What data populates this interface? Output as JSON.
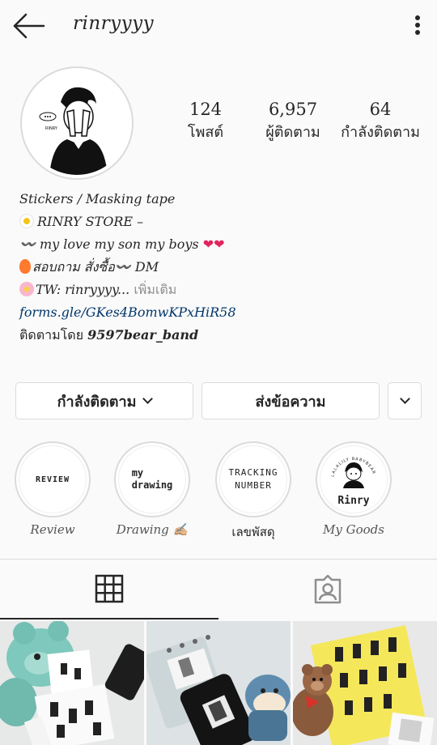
{
  "header": {
    "username": "rinryyyy"
  },
  "stats": [
    {
      "value": "124",
      "label": "โพสต์"
    },
    {
      "value": "6,957",
      "label": "ผู้ติดตาม"
    },
    {
      "value": "64",
      "label": "กำลังติดตาม"
    }
  ],
  "bio": {
    "line1": "Stickers / Masking tape",
    "line2": "RINRY STORE –",
    "line3_text": "〰️ my love my son my boys",
    "line4_text": "สอบถาม สั่งซื้อ〰️ DM",
    "line5_text": "TW: rinryyyy...",
    "line5_more": "เพิ่มเติม",
    "link": "forms.gle/GKes4BomwKPxHiR58",
    "followed_prefix": "ติดตามโดย",
    "followed_user": "9597bear_band"
  },
  "actions": {
    "following_label": "กำลังติดตาม",
    "message_label": "ส่งข้อความ"
  },
  "highlights": [
    {
      "label": "Review",
      "cover_text": "REVIEW"
    },
    {
      "label": "Drawing ✍🏼",
      "cover_line1": "my",
      "cover_line2": "drawing"
    },
    {
      "label": "เลขพัสดุ",
      "cover_line1": "TRACKING",
      "cover_line2": "NUMBER"
    },
    {
      "label": "My Goods",
      "cover_text": "Rinry",
      "cover_arc": "LALALILY BABYBEAR"
    }
  ],
  "tabs": [
    {
      "name": "grid",
      "icon": "grid-icon"
    },
    {
      "name": "tagged",
      "icon": "tagged-icon"
    }
  ],
  "icons": {
    "back": "arrow-left-icon",
    "more": "more-vertical-icon",
    "suggest": "chevron-down-icon"
  }
}
